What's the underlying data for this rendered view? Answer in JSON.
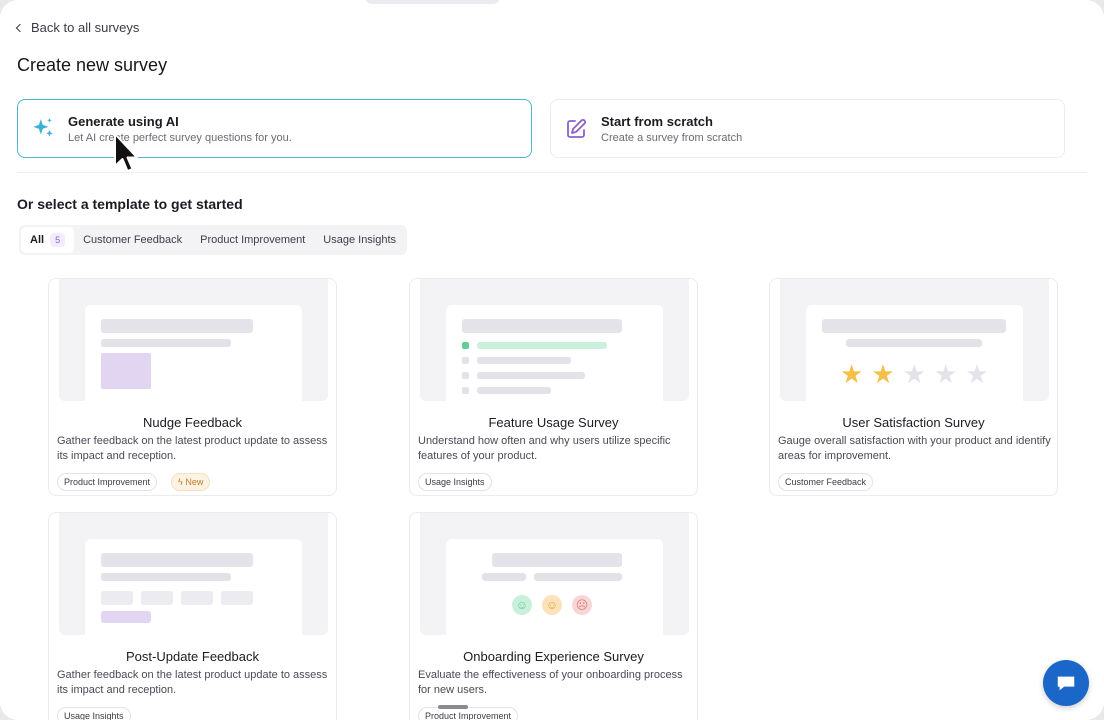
{
  "nav": {
    "back_label": "Back to all surveys"
  },
  "page": {
    "title": "Create new survey"
  },
  "options": {
    "ai": {
      "title": "Generate using AI",
      "subtitle": "Let AI create perfect survey questions for you."
    },
    "scratch": {
      "title": "Start from scratch",
      "subtitle": "Create a survey from scratch"
    }
  },
  "templates": {
    "heading": "Or select a template to get started",
    "tabs": [
      {
        "label": "All",
        "count": "5"
      },
      {
        "label": "Customer Feedback"
      },
      {
        "label": "Product Improvement"
      },
      {
        "label": "Usage Insights"
      }
    ],
    "cards": [
      {
        "title": "Nudge Feedback",
        "description": "Gather feedback on the latest product update to assess its impact and reception.",
        "tags": [
          "Product Improvement"
        ],
        "badge": "New"
      },
      {
        "title": "Feature Usage Survey",
        "description": "Understand how often and why users utilize specific features of your product.",
        "tags": [
          "Usage Insights"
        ]
      },
      {
        "title": "User Satisfaction Survey",
        "description": "Gauge overall satisfaction with your product and identify areas for improvement.",
        "tags": [
          "Customer Feedback"
        ],
        "rating": {
          "filled": 2,
          "total": 5
        }
      },
      {
        "title": "Post-Update Feedback",
        "description": "Gather feedback on the latest product update to assess its impact and reception.",
        "tags": [
          "Usage Insights"
        ]
      },
      {
        "title": "Onboarding Experience Survey",
        "description": "Evaluate the effectiveness of your onboarding process for new users.",
        "tags": [
          "Product Improvement"
        ]
      }
    ]
  },
  "colors": {
    "accent_border": "#4cb8d0",
    "ai_icon": "#3bb1d4",
    "scratch_icon": "#8a62c9",
    "chat_button": "#1b66c9",
    "star_filled": "#f5c04a",
    "star_empty": "#e3e3e9"
  },
  "icons": {
    "back": "chevron-left-icon",
    "ai": "sparkles-icon",
    "scratch": "edit-icon",
    "chat": "chat-bubble-icon",
    "cursor": "mouse-pointer-icon"
  }
}
